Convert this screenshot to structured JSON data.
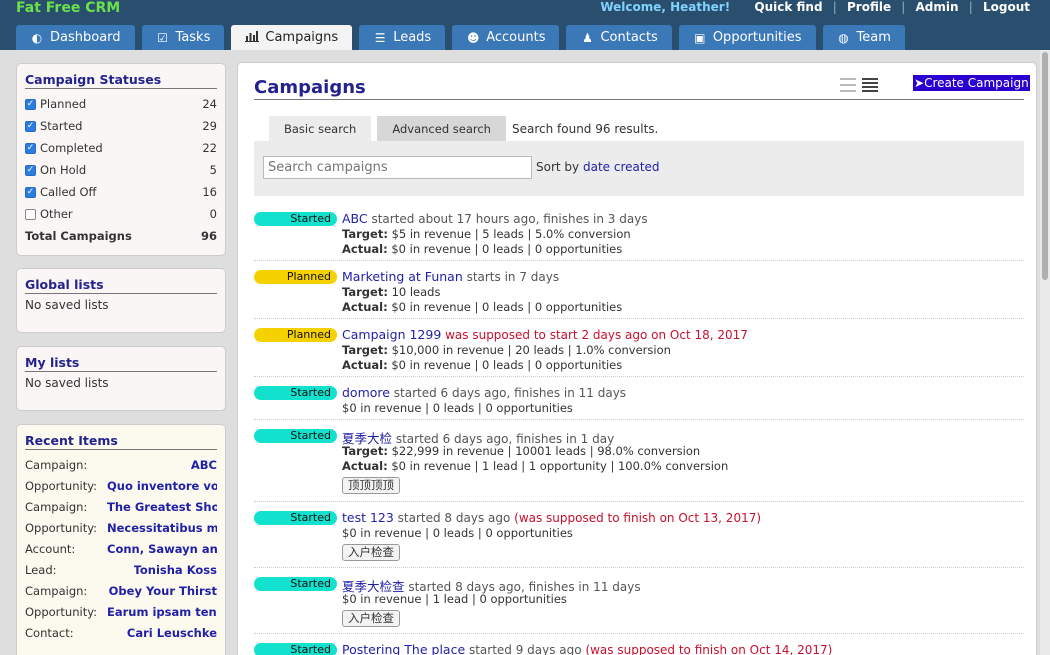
{
  "brand": "Fat Free CRM",
  "topnav": {
    "welcome": "Welcome, Heather!",
    "links": [
      "Quick find",
      "Profile",
      "Admin",
      "Logout"
    ]
  },
  "tabs": [
    {
      "label": "Dashboard",
      "icon": "dashboard-icon"
    },
    {
      "label": "Tasks",
      "icon": "check-square-icon"
    },
    {
      "label": "Campaigns",
      "icon": "bar-chart-icon",
      "active": true
    },
    {
      "label": "Leads",
      "icon": "list-icon"
    },
    {
      "label": "Accounts",
      "icon": "users-icon"
    },
    {
      "label": "Contacts",
      "icon": "user-icon"
    },
    {
      "label": "Opportunities",
      "icon": "money-icon"
    },
    {
      "label": "Team",
      "icon": "globe-icon"
    }
  ],
  "statuses": {
    "title": "Campaign Statuses",
    "items": [
      {
        "label": "Planned",
        "count": "24",
        "checked": true
      },
      {
        "label": "Started",
        "count": "29",
        "checked": true
      },
      {
        "label": "Completed",
        "count": "22",
        "checked": true
      },
      {
        "label": "On Hold",
        "count": "5",
        "checked": true
      },
      {
        "label": "Called Off",
        "count": "16",
        "checked": true
      },
      {
        "label": "Other",
        "count": "0",
        "checked": false
      }
    ],
    "total_label": "Total Campaigns",
    "total_count": "96"
  },
  "global_lists": {
    "title": "Global lists",
    "empty": "No saved lists"
  },
  "my_lists": {
    "title": "My lists",
    "empty": "No saved lists"
  },
  "recent": {
    "title": "Recent Items",
    "items": [
      {
        "type": "Campaign:",
        "name": "ABC"
      },
      {
        "type": "Opportunity:",
        "name": "Quo inventore vo..."
      },
      {
        "type": "Campaign:",
        "name": "The Greatest Sho..."
      },
      {
        "type": "Opportunity:",
        "name": "Necessitatibus m..."
      },
      {
        "type": "Account:",
        "name": "Conn, Sawayn and..."
      },
      {
        "type": "Lead:",
        "name": "Tonisha Koss"
      },
      {
        "type": "Campaign:",
        "name": "Obey Your Thirst"
      },
      {
        "type": "Opportunity:",
        "name": "Earum ipsam tene..."
      },
      {
        "type": "Contact:",
        "name": "Cari Leuschke"
      }
    ]
  },
  "main": {
    "title": "Campaigns",
    "create_label": "Create Campaign",
    "search_tabs": [
      "Basic search",
      "Advanced search"
    ],
    "search_found": "Search found 96 results.",
    "search_placeholder": "Search campaigns",
    "sort_prefix": "Sort by",
    "sort_value": "date created"
  },
  "colors": {
    "started": "#12e1ce",
    "planned": "#f5d100",
    "link": "#1f1fa8",
    "warn": "#c8102e"
  },
  "campaigns": [
    {
      "status": "Started",
      "name": "ABC",
      "info": " started about 17 hours ago, finishes in 3 days",
      "target_label": "Target:",
      "target": " $5 in revenue | 5 leads | 5.0% conversion",
      "actual_label": "Actual:",
      "actual": " $0 in revenue | 0 leads | 0 opportunities"
    },
    {
      "status": "Planned",
      "name": "Marketing at Funan",
      "info": " starts in 7 days",
      "target_label": "Target:",
      "target": " 10 leads",
      "actual_label": "Actual:",
      "actual": " $0 in revenue | 0 leads | 0 opportunities"
    },
    {
      "status": "Planned",
      "name": "Campaign 1299",
      "warn": " was supposed to start 2 days ago on Oct 18, 2017",
      "target_label": "Target:",
      "target": " $10,000 in revenue | 20 leads | 1.0% conversion",
      "actual_label": "Actual:",
      "actual": " $0 in revenue | 0 leads | 0 opportunities"
    },
    {
      "status": "Started",
      "name": "domore",
      "info": " started 6 days ago, finishes in 11 days",
      "plain": "$0 in revenue | 0 leads | 0 opportunities"
    },
    {
      "status": "Started",
      "name": "夏季大检",
      "info": " started 6 days ago, finishes in 1 day",
      "target_label": "Target:",
      "target": " $22,999 in revenue | 10001 leads | 98.0% conversion",
      "actual_label": "Actual:",
      "actual": " $0 in revenue | 1 lead | 1 opportunity | 100.0% conversion",
      "tag": "顶顶顶顶"
    },
    {
      "status": "Started",
      "name": "test 123",
      "info": " started 8 days ago ",
      "warn": "(was supposed to finish on Oct 13, 2017)",
      "plain": "$0 in revenue | 0 leads | 0 opportunities",
      "tag": "入户检查"
    },
    {
      "status": "Started",
      "name": "夏季大检查",
      "info": " started 8 days ago, finishes in 11 days",
      "plain": "$0 in revenue | 1 lead | 0 opportunities",
      "tag": "入户检查"
    },
    {
      "status": "Started",
      "name": "Postering The place",
      "info": " started 9 days ago ",
      "warn": "(was supposed to finish on Oct 14, 2017)"
    }
  ]
}
